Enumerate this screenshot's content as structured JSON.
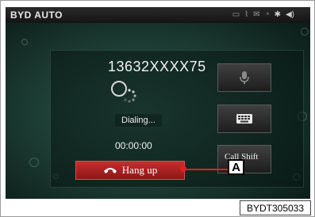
{
  "app": {
    "brand": "BYD AUTO"
  },
  "status_bar": {
    "icons": [
      "phone-link-icon",
      "signal-icon",
      "message-icon",
      "network-icon",
      "bluetooth-icon",
      "volume-icon"
    ]
  },
  "call": {
    "number": "13632XXXX75",
    "status": "Dialing...",
    "duration": "00:00:00"
  },
  "buttons": {
    "hang_up": "Hang up",
    "call_shift": "Call Shift"
  },
  "callout": {
    "label": "A"
  },
  "figure": {
    "code": "BYDT305033"
  },
  "colors": {
    "hangup": "#b52525",
    "leader": "#e02020",
    "background": "#1d3d34"
  }
}
